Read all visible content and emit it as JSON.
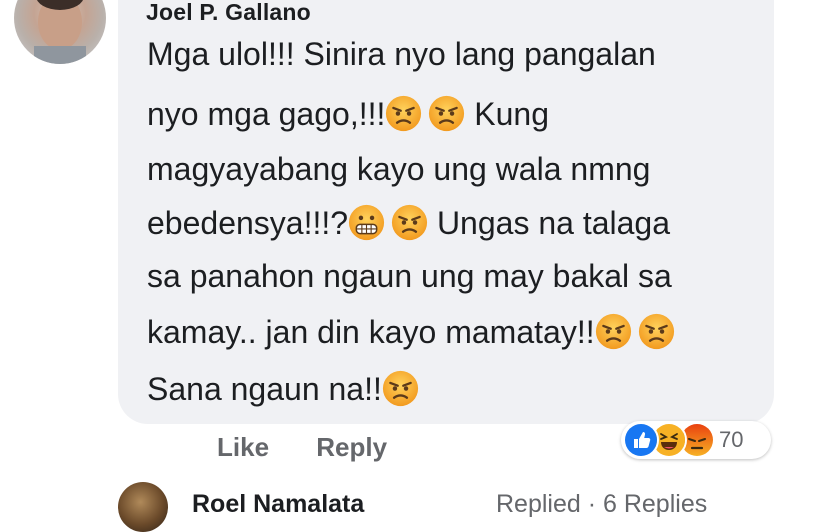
{
  "comment": {
    "author": "Joel P. Gallano",
    "lines": [
      {
        "text": [
          "Mga ulol!!! Sinira nyo lang pangalan"
        ],
        "emojis_after": []
      },
      {
        "text": [
          "nyo mga gago,!!!",
          "",
          " Kung"
        ]
      },
      {
        "text": [
          "magyayabang kayo ung wala nmng"
        ]
      },
      {
        "text": [
          "ebedensya!!!?",
          "",
          " Ungas na talaga"
        ]
      },
      {
        "text": [
          "sa panahon ngaun ung may bakal sa"
        ]
      },
      {
        "text": [
          "kamay.. jan din kayo mamatay!!",
          ""
        ]
      },
      {
        "text": [
          "Sana ngaun na!!"
        ]
      }
    ],
    "line1": "Mga ulol!!! Sinira nyo lang pangalan",
    "line2a": "nyo mga gago,!!!",
    "line2b": " Kung",
    "line3": "magyayabang kayo ung wala nmng",
    "line4a": "ebedensya!!!?",
    "line4b": " Ungas na talaga",
    "line5": "sa panahon ngaun ung may bakal sa",
    "line6": "kamay.. jan din kayo mamatay!!",
    "line7": "Sana ngaun na!!"
  },
  "actions": {
    "like_label": "Like",
    "reply_label": "Reply"
  },
  "reactions": {
    "icons": [
      "like-icon",
      "haha-icon",
      "angry-icon"
    ],
    "count": "70",
    "colors": {
      "like": "#1877f2",
      "haha": "#f7b125",
      "angry": "#e9710f"
    }
  },
  "reply_summary": {
    "name": "Roel Namalata",
    "text": "Replied · 6 Replies"
  },
  "emoji_names": [
    "angry-face-icon",
    "grimacing-face-icon"
  ]
}
